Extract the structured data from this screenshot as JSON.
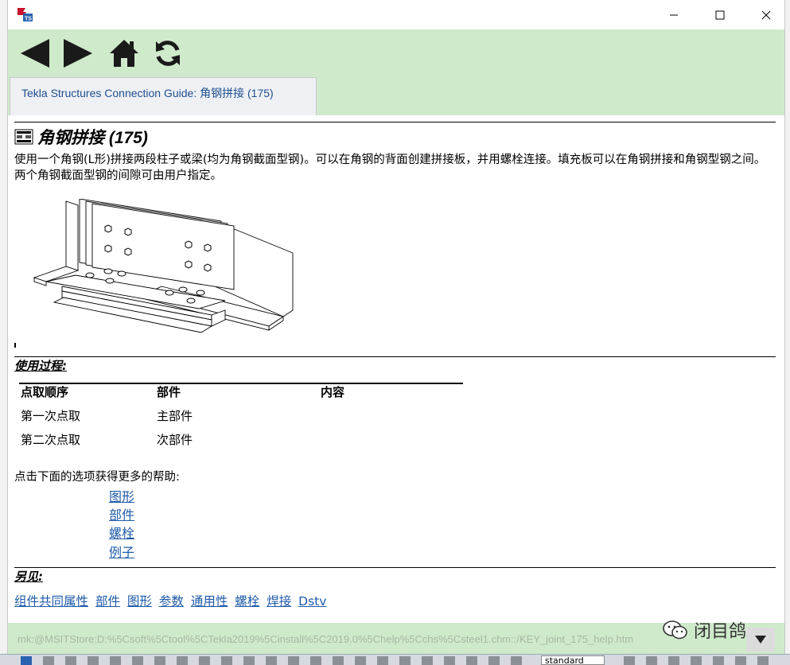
{
  "window": {
    "title": "",
    "controls": [
      "minimize-icon",
      "maximize-icon",
      "close-icon"
    ]
  },
  "toolbar": {
    "buttons": [
      "back-arrow-icon",
      "forward-arrow-icon",
      "home-icon",
      "refresh-icon"
    ],
    "tab_label": "Tekla Structures Connection Guide: 角钢拼接 (175)"
  },
  "article": {
    "title": "角钢拼接 (175)",
    "intro": "使用一个角钢(L形)拼接两段柱子或梁(均为角钢截面型钢)。可以在角钢的背面创建拼接板，并用螺栓连接。填充板可以在角钢拼接和角钢型钢之间。两个角钢截面型钢的间隙可由用户指定。",
    "usage_heading": "使用过程:",
    "table": {
      "headers": [
        "点取顺序",
        "部件",
        "内容"
      ],
      "rows": [
        [
          "第一次点取",
          "主部件",
          ""
        ],
        [
          "第二次点取",
          "次部件",
          ""
        ]
      ]
    },
    "help_intro": "点击下面的选项获得更多的帮助:",
    "help_links": [
      "图形",
      "部件",
      "螺栓",
      "例子"
    ],
    "see_also_heading": "另见:",
    "see_also_links": [
      "组件共同属性",
      "部件",
      "图形",
      "参数",
      "通用性",
      "螺栓",
      "焊接",
      "Dstv"
    ]
  },
  "statusbar": {
    "url": "mk:@MSITStore:D:%5Csoft%5Ctool%5CTekla2019%5Cinstall%5C2019.0%5Chelp%5Cchs%5Csteel1.chm::/KEY_joint_175_help.htm"
  },
  "watermark": {
    "text": "闭目鸽"
  },
  "taskbar": {
    "select_value": "standard"
  },
  "colors": {
    "toolbar_bg": "#cfeacb",
    "link": "#1e5aa8",
    "tab_bg": "#eef0f4"
  }
}
